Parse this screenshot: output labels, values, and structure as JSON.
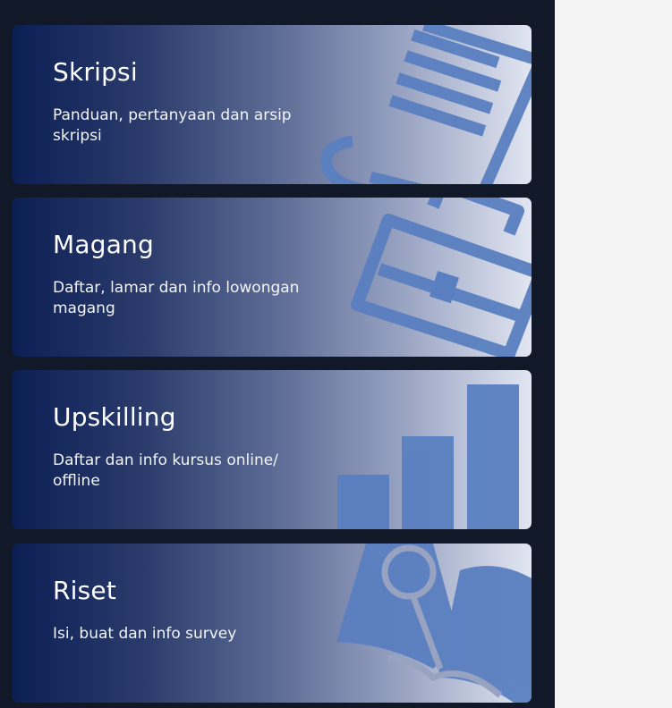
{
  "cards": [
    {
      "title": "Skripsi",
      "description": "Panduan, pertanyaan dan arsip skripsi",
      "icon": "document-scroll-icon"
    },
    {
      "title": "Magang",
      "description": "Daftar, lamar dan info lowongan magang",
      "icon": "briefcase-icon"
    },
    {
      "title": "Upskilling",
      "description": "Daftar dan info kursus online/ offline",
      "icon": "bar-chart-icon"
    },
    {
      "title": "Riset",
      "description": "Isi, buat dan info survey",
      "icon": "book-magnifier-icon"
    }
  ],
  "colors": {
    "panel": "#111827",
    "gradient_start": "#0c1f55",
    "gradient_end": "#e2e6f2",
    "illustration": "#5a7fc0",
    "page_background": "#f4f4f5"
  }
}
